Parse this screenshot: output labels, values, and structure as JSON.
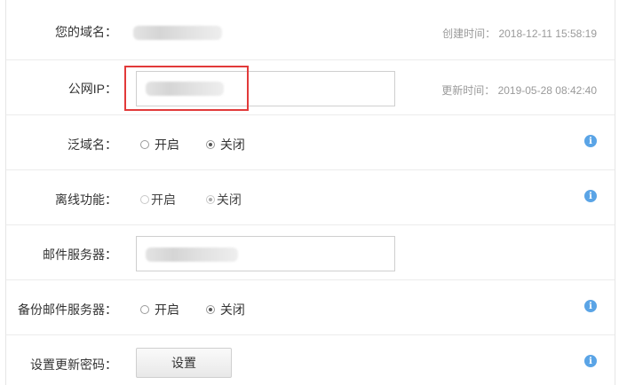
{
  "rows": {
    "domain": {
      "label": "您的域名：",
      "meta": "创建时间： 2018-12-11 15:58:19"
    },
    "public_ip": {
      "label": "公网IP：",
      "meta": "更新时间： 2019-05-28 08:42:40"
    },
    "wildcard": {
      "label": "泛域名：",
      "opt_on": "开启",
      "opt_off": "关闭",
      "selected": "关闭"
    },
    "offline": {
      "label": "离线功能：",
      "opt_on": "开启",
      "opt_off": "关闭",
      "selected": "关闭"
    },
    "mail": {
      "label": "邮件服务器："
    },
    "backup_mail": {
      "label": "备份邮件服务器：",
      "opt_on": "开启",
      "opt_off": "关闭",
      "selected": "关闭"
    },
    "password": {
      "label": "设置更新密码：",
      "button": "设置"
    }
  },
  "icons": {
    "info": "info-icon"
  },
  "colors": {
    "highlight": "#e23a3a",
    "info": "#5aa4e6"
  }
}
